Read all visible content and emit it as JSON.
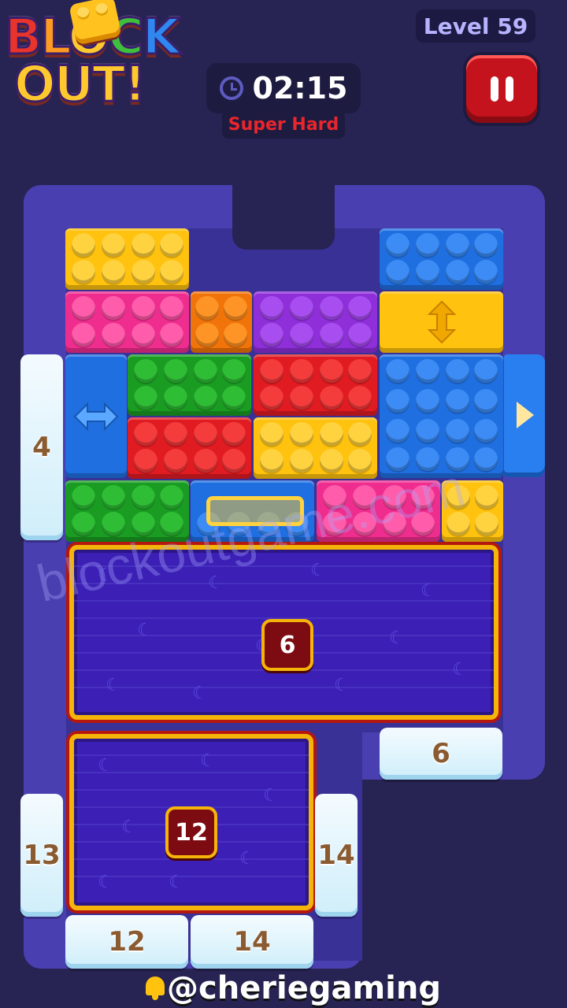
{
  "header": {
    "logo_line1": [
      "B",
      "L",
      "O",
      "C",
      "K"
    ],
    "logo_line2": "OUT!",
    "level": "Level 59",
    "timer": "02:15",
    "difficulty": "Super Hard"
  },
  "board": {
    "trays": [
      {
        "count": "6"
      },
      {
        "count": "12"
      }
    ],
    "ice_counters": {
      "left_top": "4",
      "right_mid": "6",
      "left_bottom": "13",
      "mid_right": "14",
      "bottom_left": "12",
      "bottom_right": "14"
    }
  },
  "watermark": "blockoutgame.com",
  "footer": {
    "handle": "@cheriegaming",
    "icon": "bell-icon"
  },
  "colors": {
    "background": "#272353",
    "board": "#4a3fb0",
    "yellow": "#ffc20e",
    "pink": "#ef2d8e",
    "orange": "#f0740a",
    "purple": "#8e2fd9",
    "blue": "#1f6fe0",
    "green": "#1a9c22",
    "red": "#e01c22"
  }
}
